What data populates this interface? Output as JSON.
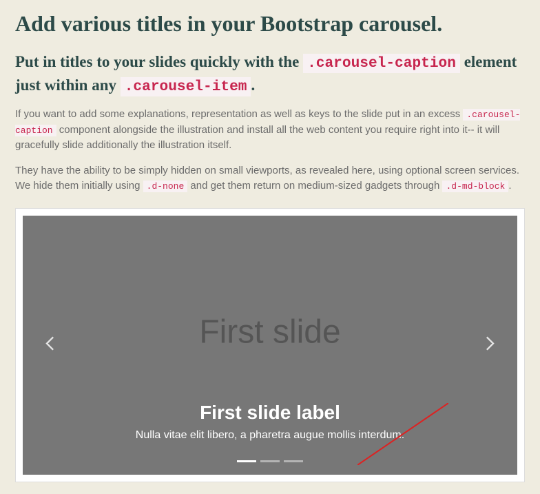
{
  "title": "Add various titles in your Bootstrap carousel.",
  "subheading": {
    "part1": "Put in titles to your slides quickly with the ",
    "code1": ".carousel-caption",
    "part2": " element just within any ",
    "code2": ".carousel-item",
    "part3": "."
  },
  "para1": {
    "a": "If you want to add some explanations, representation as well as keys to the slide put in an excess ",
    "code": ".carousel-caption",
    "b": " component alongside the illustration and install all the web content you require right into it-- it will gracefully slide additionally the illustration itself."
  },
  "para2": {
    "a": "They have the ability to be simply hidden on small viewports, as revealed here, using optional screen services. We hide them initially using ",
    "code1": ".d-none",
    "b": " and get them return on medium-sized gadgets through ",
    "code2": ".d-md-block",
    "c": "."
  },
  "carousel": {
    "placeholder": "First slide",
    "caption_title": "First slide label",
    "caption_text": "Nulla vitae elit libero, a pharetra augue mollis interdum.",
    "indicators": 3,
    "active_index": 0
  }
}
